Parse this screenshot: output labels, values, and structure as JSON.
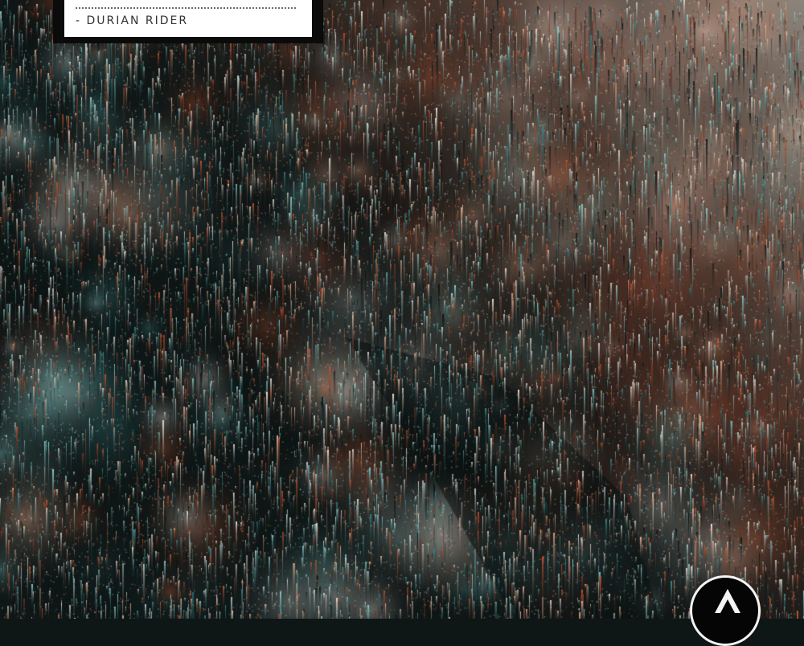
{
  "quote": {
    "author": "- DURIAN RIDER"
  },
  "palette": {
    "dark": "#0e1616",
    "teal": "#3f8a8c",
    "cyan": "#8fd1cf",
    "orange": "#c8562f",
    "peach": "#e9b89c",
    "cream": "#f1e6dc"
  },
  "icons": {
    "logo": "peak-logo-icon"
  }
}
